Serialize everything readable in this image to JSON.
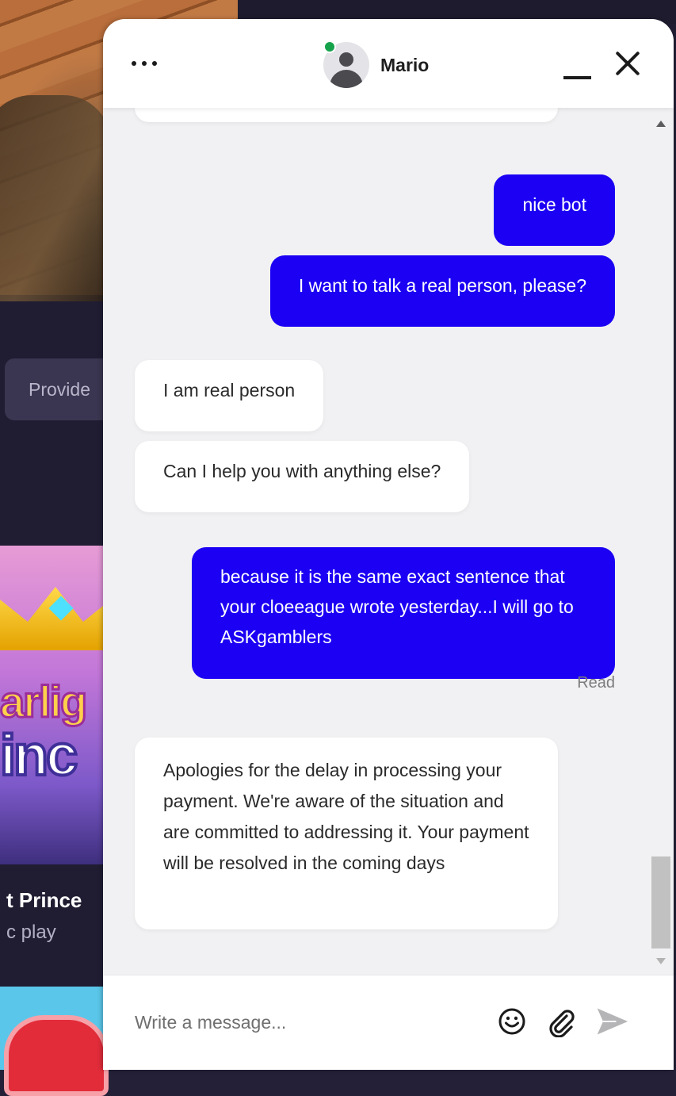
{
  "background": {
    "provider_chip": "Provide",
    "game_logo_line1": "arlig",
    "game_logo_line2": "inc",
    "game_name": "t Prince",
    "game_sub": "c play"
  },
  "chat": {
    "agent_name": "Mario",
    "agent_status": "online",
    "icons": {
      "menu": "more-options-icon",
      "minimize": "minimize-icon",
      "close": "close-icon",
      "emoji": "emoji-icon",
      "attach": "paperclip-icon",
      "send": "send-icon"
    },
    "colors": {
      "outgoing_bubble": "#1b00f3",
      "incoming_bubble": "#ffffff",
      "online": "#15a24a"
    },
    "messages": [
      {
        "direction": "out",
        "text": "nice bot"
      },
      {
        "direction": "out",
        "text": "I want to talk a real person, please?"
      },
      {
        "direction": "in",
        "text": "I am real person"
      },
      {
        "direction": "in",
        "text": "Can I help you with anything else?"
      },
      {
        "direction": "out",
        "text": "because it is the same exact sentence that your cloeeague wrote yesterday...I will go to ASKgamblers"
      },
      {
        "direction": "in",
        "text": "Apologies for the delay in processing your payment. We're aware of the situation and are committed to addressing it. Your payment will be resolved in the coming days"
      }
    ],
    "read_status": "Read",
    "composer": {
      "placeholder": "Write a message..."
    }
  }
}
